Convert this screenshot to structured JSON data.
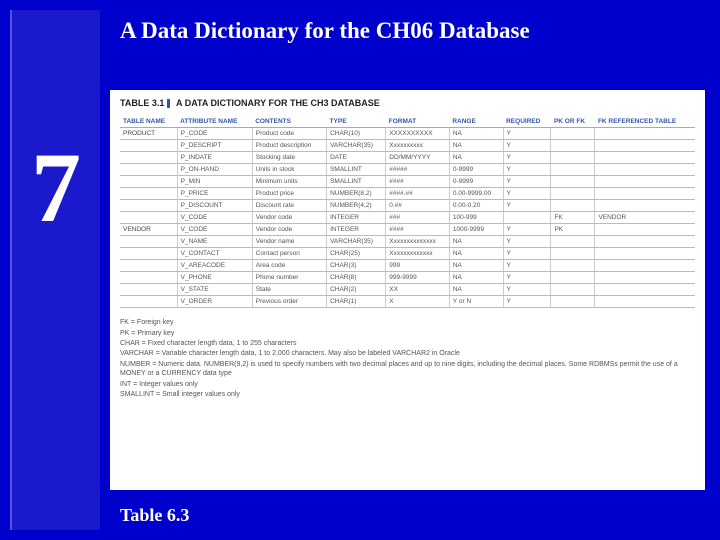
{
  "sidebar": {
    "page_number": "7"
  },
  "title": "A Data Dictionary for the CH06 Database",
  "footer": "Table 6.3",
  "table_caption": "A DATA DICTIONARY FOR THE CH3 DATABASE",
  "table_caption_prefix": "TABLE 3.1",
  "headers": [
    "TABLE NAME",
    "ATTRIBUTE NAME",
    "CONTENTS",
    "TYPE",
    "FORMAT",
    "RANGE",
    "REQUIRED",
    "PK OR FK",
    "FK REFERENCED TABLE"
  ],
  "rows": [
    {
      "table": "PRODUCT",
      "attr": "P_CODE",
      "contents": "Product code",
      "type": "CHAR(10)",
      "format": "XXXXXXXXXX",
      "range": "NA",
      "required": "Y",
      "pkfk": "",
      "fkref": ""
    },
    {
      "table": "",
      "attr": "P_DESCRIPT",
      "contents": "Product description",
      "type": "VARCHAR(35)",
      "format": "Xxxxxxxxxx",
      "range": "NA",
      "required": "Y",
      "pkfk": "",
      "fkref": ""
    },
    {
      "table": "",
      "attr": "P_INDATE",
      "contents": "Stocking date",
      "type": "DATE",
      "format": "DD/MM/YYYY",
      "range": "NA",
      "required": "Y",
      "pkfk": "",
      "fkref": ""
    },
    {
      "table": "",
      "attr": "P_ON-HAND",
      "contents": "Units in stock",
      "type": "SMALLINT",
      "format": "#####",
      "range": "0-9999",
      "required": "Y",
      "pkfk": "",
      "fkref": ""
    },
    {
      "table": "",
      "attr": "P_MIN",
      "contents": "Minimum units",
      "type": "SMALLINT",
      "format": "####",
      "range": "0-9999",
      "required": "Y",
      "pkfk": "",
      "fkref": ""
    },
    {
      "table": "",
      "attr": "P_PRICE",
      "contents": "Product price",
      "type": "NUMBER(8,2)",
      "format": "####.##",
      "range": "0.00-9999.00",
      "required": "Y",
      "pkfk": "",
      "fkref": ""
    },
    {
      "table": "",
      "attr": "P_DISCOUNT",
      "contents": "Discount rate",
      "type": "NUMBER(4,2)",
      "format": "0.##",
      "range": "0.00-0.20",
      "required": "Y",
      "pkfk": "",
      "fkref": ""
    },
    {
      "table": "",
      "attr": "V_CODE",
      "contents": "Vendor code",
      "type": "INTEGER",
      "format": "###",
      "range": "100-999",
      "required": "",
      "pkfk": "FK",
      "fkref": "VENDOR"
    },
    {
      "table": "VENDOR",
      "attr": "V_CODE",
      "contents": "Vendor code",
      "type": "INTEGER",
      "format": "####",
      "range": "1000-9999",
      "required": "Y",
      "pkfk": "PK",
      "fkref": ""
    },
    {
      "table": "",
      "attr": "V_NAME",
      "contents": "Vendor name",
      "type": "VARCHAR(35)",
      "format": "Xxxxxxxxxxxxxx",
      "range": "NA",
      "required": "Y",
      "pkfk": "",
      "fkref": ""
    },
    {
      "table": "",
      "attr": "V_CONTACT",
      "contents": "Contact person",
      "type": "CHAR(25)",
      "format": "Xxxxxxxxxxxxx",
      "range": "NA",
      "required": "Y",
      "pkfk": "",
      "fkref": ""
    },
    {
      "table": "",
      "attr": "V_AREACODE",
      "contents": "Area code",
      "type": "CHAR(3)",
      "format": "999",
      "range": "NA",
      "required": "Y",
      "pkfk": "",
      "fkref": ""
    },
    {
      "table": "",
      "attr": "V_PHONE",
      "contents": "Phone number",
      "type": "CHAR(8)",
      "format": "999-9999",
      "range": "NA",
      "required": "Y",
      "pkfk": "",
      "fkref": ""
    },
    {
      "table": "",
      "attr": "V_STATE",
      "contents": "State",
      "type": "CHAR(2)",
      "format": "XX",
      "range": "NA",
      "required": "Y",
      "pkfk": "",
      "fkref": ""
    },
    {
      "table": "",
      "attr": "V_ORDER",
      "contents": "Previous order",
      "type": "CHAR(1)",
      "format": "X",
      "range": "Y or N",
      "required": "Y",
      "pkfk": "",
      "fkref": ""
    }
  ],
  "legend": [
    "FK = Foreign key",
    "PK = Primary key",
    "CHAR = Fixed character length data, 1 to 255 characters",
    "VARCHAR = Variable character length data, 1 to 2,000 characters. May also be labeled VARCHAR2 in Oracle",
    "NUMBER = Numeric data. NUMBER(9,2) is used to specify numbers with two decimal places and up to nine digits, including the decimal places. Some RDBMSs permit the use of a MONEY or a CURRENCY data type",
    "INT = Integer values only",
    "SMALLINT = Small integer values only"
  ]
}
